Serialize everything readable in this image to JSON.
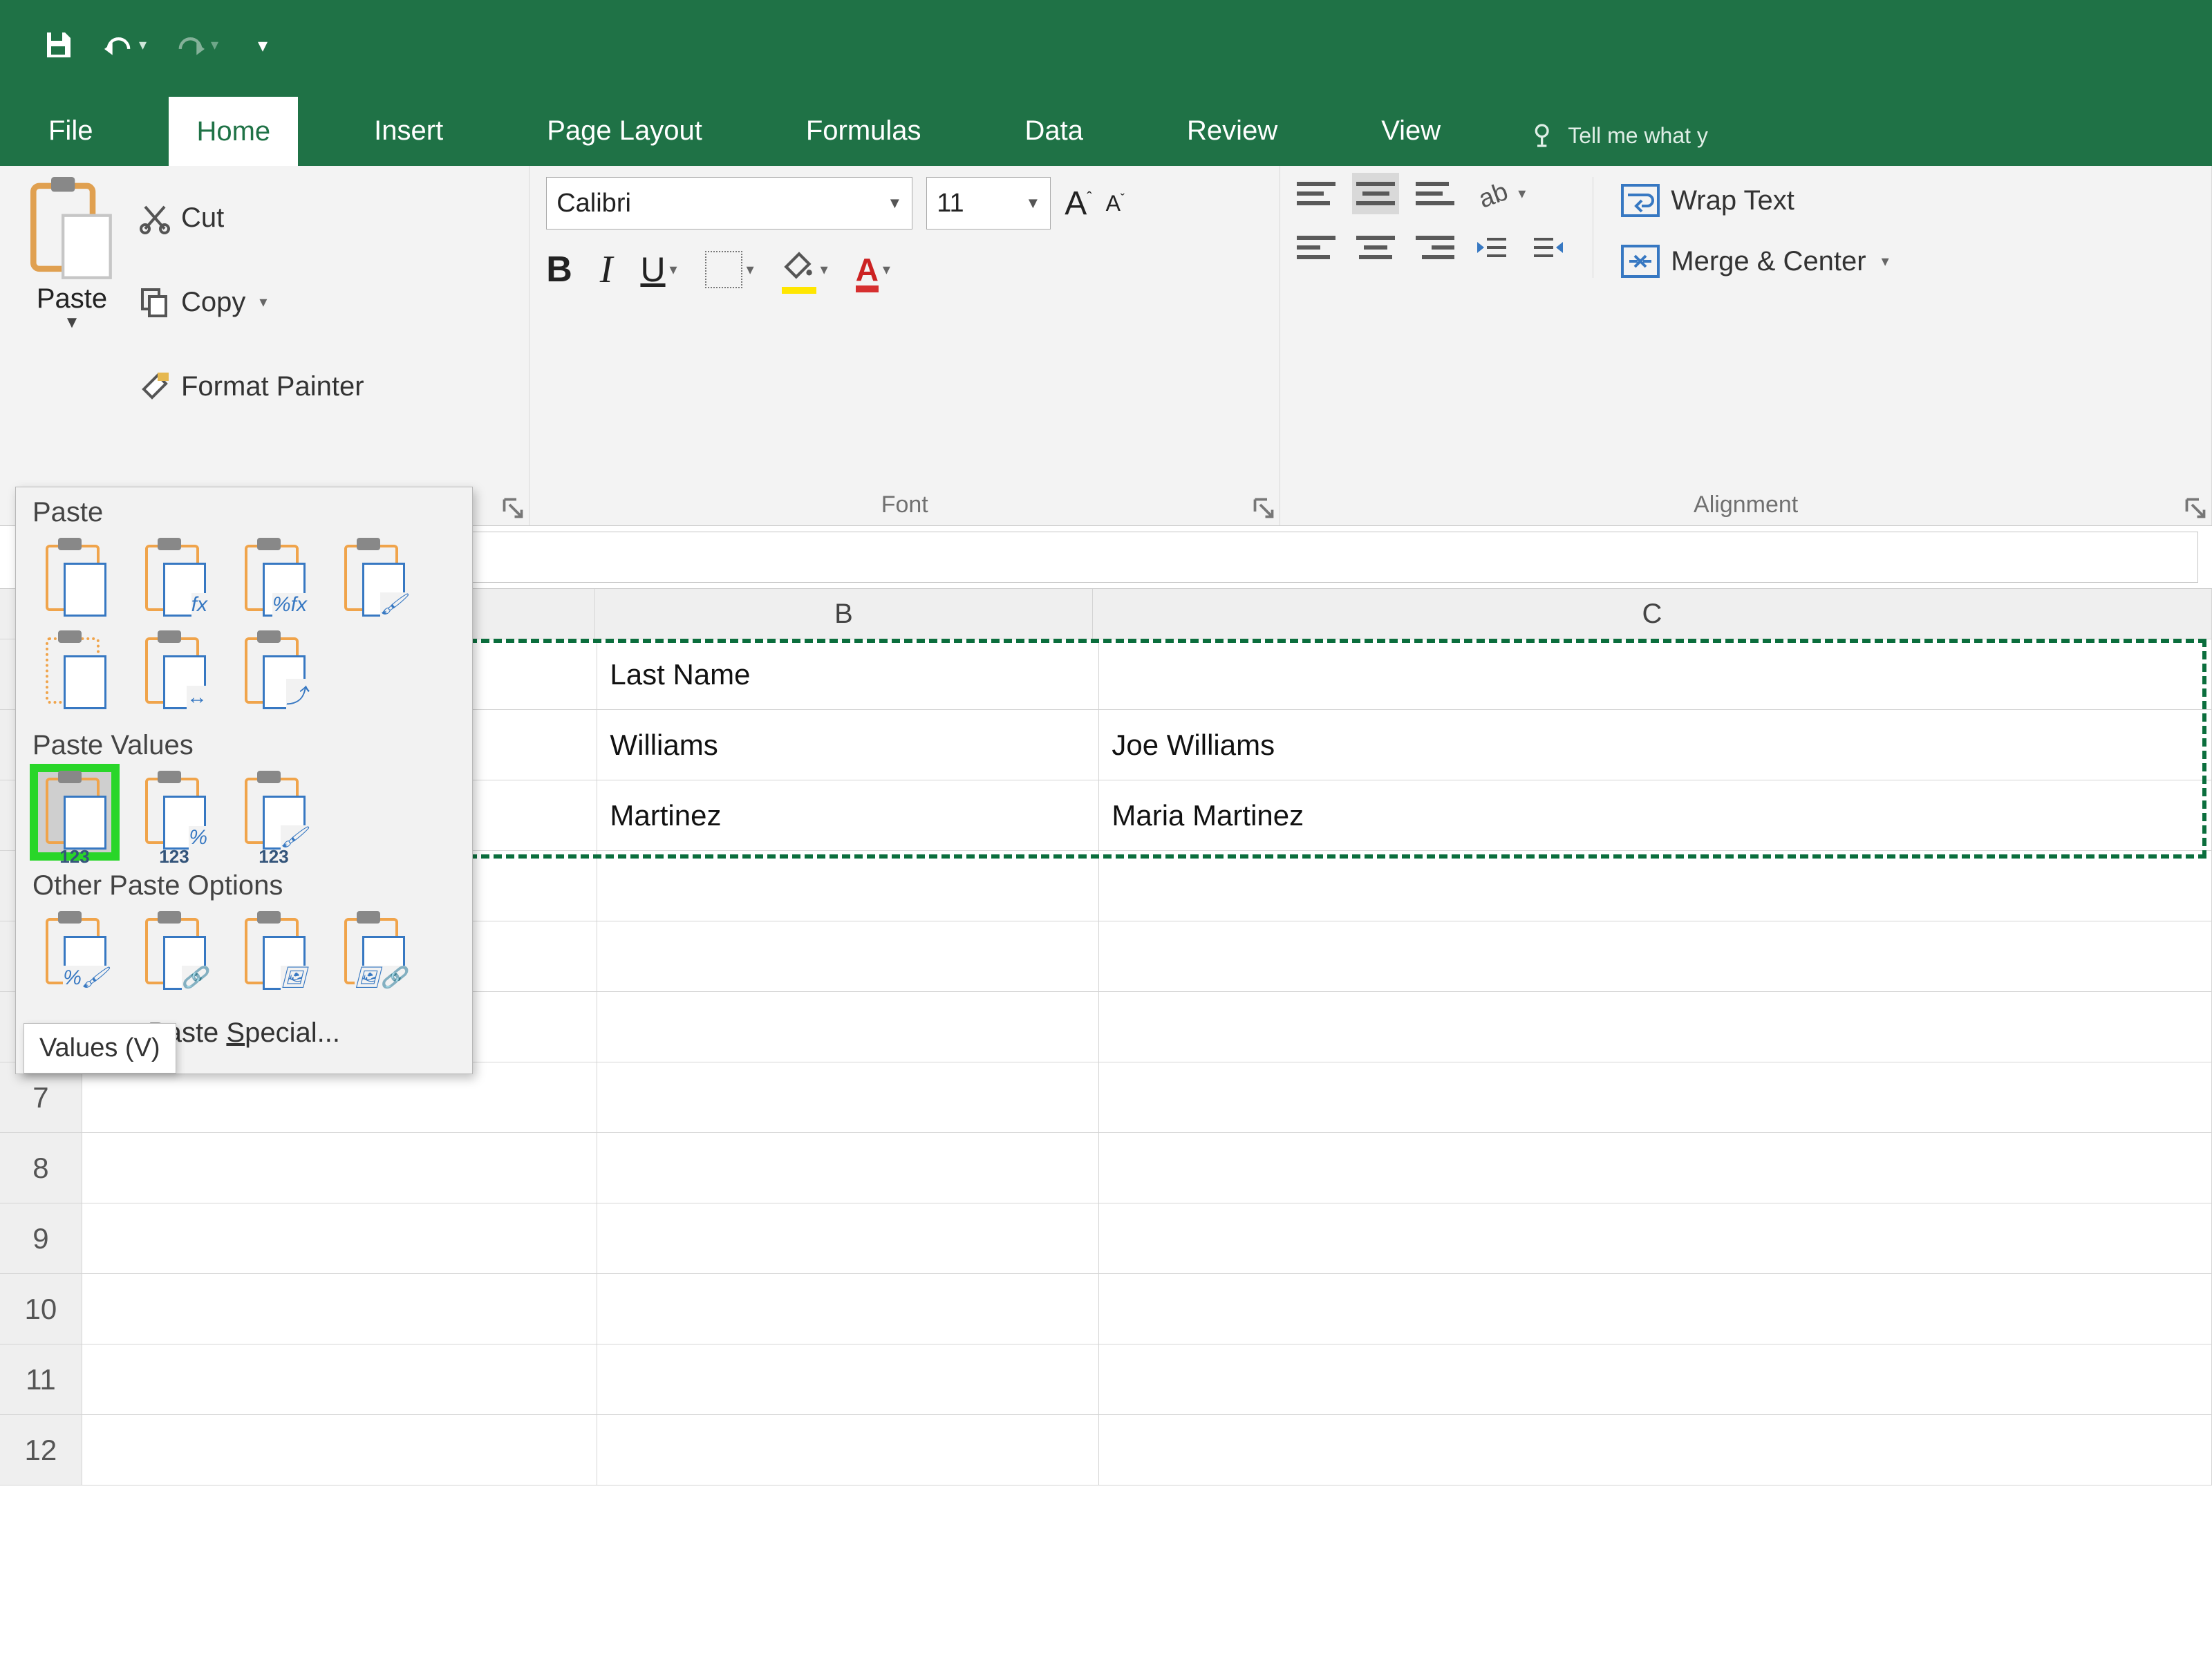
{
  "qat": {},
  "tabs": {
    "file": "File",
    "home": "Home",
    "insert": "Insert",
    "page_layout": "Page Layout",
    "formulas": "Formulas",
    "data": "Data",
    "review": "Review",
    "view": "View",
    "tell_me": "Tell me what y"
  },
  "ribbon": {
    "clipboard": {
      "paste": "Paste",
      "cut": "Cut",
      "copy": "Copy",
      "format_painter": "Format Painter"
    },
    "font": {
      "name": "Calibri",
      "size": "11",
      "group_title": "Font"
    },
    "alignment": {
      "wrap_text": "Wrap Text",
      "merge_center": "Merge & Center",
      "group_title": "Alignment"
    }
  },
  "paste_menu": {
    "section_paste": "Paste",
    "section_values": "Paste Values",
    "section_other": "Other Paste Options",
    "values_sub": "123",
    "percent_sub": "123",
    "fmt_sub": "123",
    "special": "Paste Special...",
    "tooltip": "Values (V)",
    "badges": {
      "fx": "fx",
      "pctfx": "%fx"
    }
  },
  "sheet": {
    "columns": {
      "B": "B",
      "C": "C"
    },
    "rows": {
      "r1": {
        "B": "Last Name",
        "C": ""
      },
      "r2": {
        "B": "Williams",
        "C": "Joe Williams"
      },
      "r3": {
        "B": "Martinez",
        "C": "Maria Martinez"
      }
    },
    "row_numbers": [
      "7",
      "8",
      "9",
      "10",
      "11",
      "12"
    ]
  }
}
